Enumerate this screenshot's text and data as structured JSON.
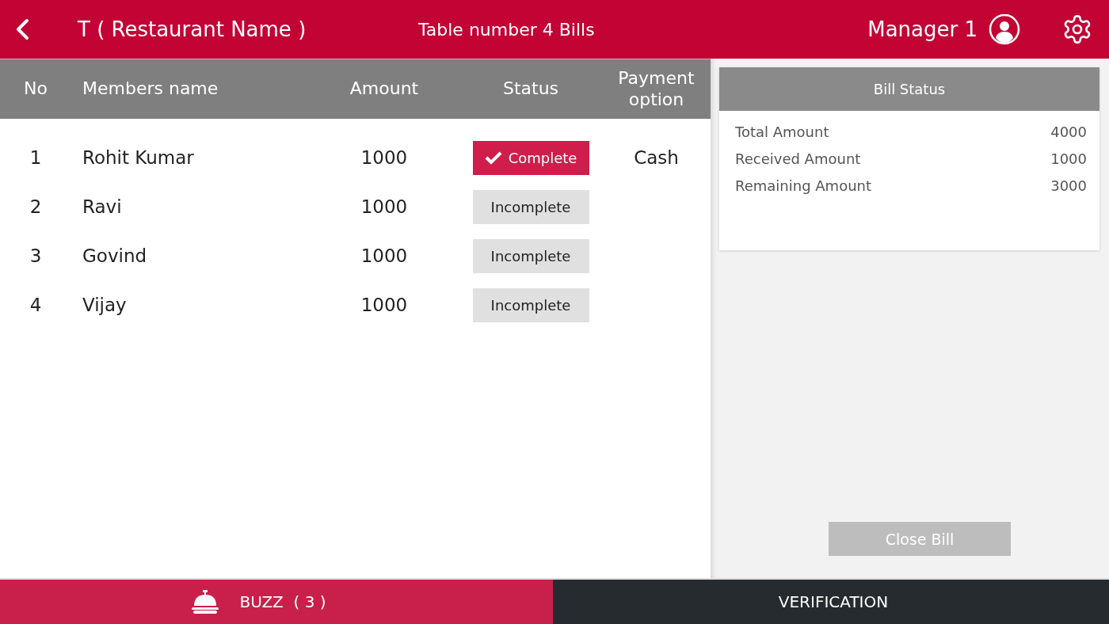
{
  "header": {
    "restaurant": "T ( Restaurant Name )",
    "title": "Table number 4 Bills",
    "user": "Manager 1"
  },
  "table": {
    "columns": [
      "No",
      "Members name",
      "Amount",
      "Status",
      "Payment option"
    ],
    "rows": [
      {
        "no": "1",
        "name": "Rohit Kumar",
        "amount": "1000",
        "status": {
          "label": "Complete",
          "complete": true
        },
        "payment": "Cash"
      },
      {
        "no": "2",
        "name": "Ravi",
        "amount": "1000",
        "status": {
          "label": "Incomplete",
          "complete": false
        }
      },
      {
        "no": "3",
        "name": "Govind",
        "amount": "1000",
        "status": {
          "label": "Incomplete",
          "complete": false
        }
      },
      {
        "no": "4",
        "name": "Vijay",
        "amount": "1000",
        "status": {
          "label": "Incomplete",
          "complete": false
        }
      }
    ]
  },
  "bill_status": {
    "title": "Bill Status",
    "items": [
      {
        "label": "Total Amount",
        "value": "4000"
      },
      {
        "label": "Received Amount",
        "value": "1000"
      },
      {
        "label": "Remaining Amount",
        "value": "3000"
      }
    ],
    "close_button": {
      "label": "Close Bill",
      "disabled": true
    }
  },
  "bottom_bar": [
    {
      "kind": "buzz",
      "label": "BUZZ  ( 3 )"
    },
    {
      "kind": "plain",
      "label": "VERIFICATION"
    }
  ]
}
